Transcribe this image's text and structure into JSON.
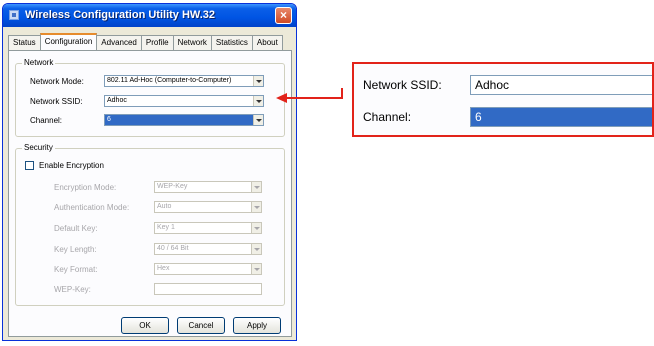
{
  "window": {
    "title": "Wireless Configuration Utility HW.32",
    "close": "×"
  },
  "tabs": [
    "Status",
    "Configuration",
    "Advanced",
    "Profile",
    "Network",
    "Statistics",
    "About"
  ],
  "network": {
    "title": "Network",
    "mode_label": "Network Mode:",
    "mode_value": "802.11 Ad-Hoc (Computer-to-Computer)",
    "ssid_label": "Network SSID:",
    "ssid_value": "Adhoc",
    "channel_label": "Channel:",
    "channel_value": "6"
  },
  "security": {
    "title": "Security",
    "enable_label": "Enable Encryption",
    "encryption_mode_label": "Encryption Mode:",
    "encryption_mode_value": "WEP-Key",
    "auth_mode_label": "Authentication Mode:",
    "auth_mode_value": "Auto",
    "default_key_label": "Default Key:",
    "default_key_value": "Key 1",
    "key_length_label": "Key Length:",
    "key_length_value": "40 / 64 Bit",
    "key_format_label": "Key Format:",
    "key_format_value": "Hex",
    "wep_key_label": "WEP-Key:"
  },
  "buttons": {
    "ok": "OK",
    "cancel": "Cancel",
    "apply": "Apply"
  },
  "zoom": {
    "ssid_label": "Network SSID:",
    "ssid_value": "Adhoc",
    "channel_label": "Channel:",
    "channel_value": "6"
  },
  "colors": {
    "highlight": "#e2231a",
    "selection": "#316ac5",
    "titlebar": "#0054e3"
  }
}
